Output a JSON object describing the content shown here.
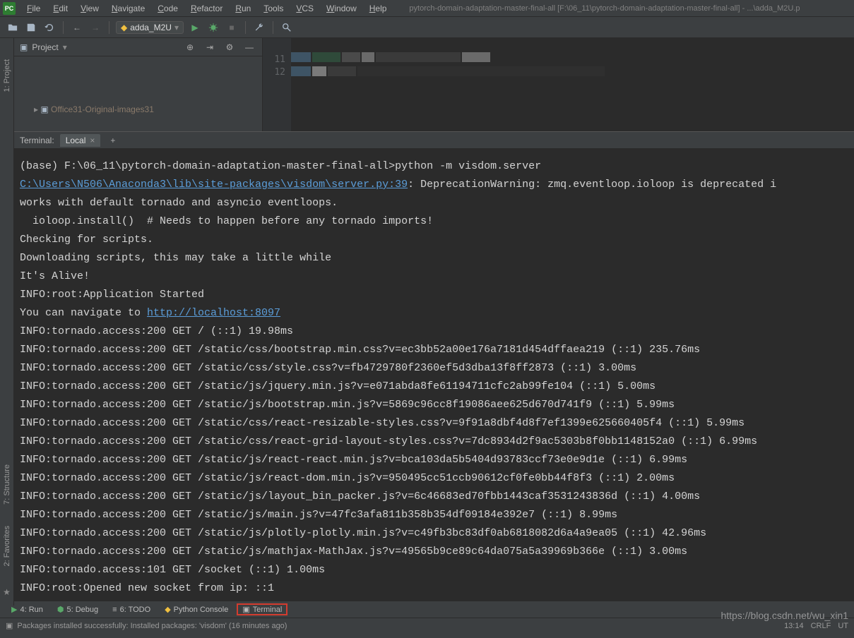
{
  "title": "pytorch-domain-adaptation-master-final-all [F:\\06_11\\pytorch-domain-adaptation-master-final-all] - ...\\adda_M2U.p",
  "menu": [
    "File",
    "Edit",
    "View",
    "Navigate",
    "Code",
    "Refactor",
    "Run",
    "Tools",
    "VCS",
    "Window",
    "Help"
  ],
  "run_config": "adda_M2U",
  "project_panel": {
    "title": "Project",
    "tree_item": "Office31-Original-images31"
  },
  "editor": {
    "line_numbers": [
      "11",
      "12"
    ]
  },
  "side_tabs": {
    "project": "1: Project",
    "structure": "7: Structure",
    "favorites": "2: Favorites"
  },
  "terminal": {
    "label": "Terminal:",
    "tab": "Local",
    "lines": [
      {
        "t": "plain",
        "v": ""
      },
      {
        "t": "plain",
        "v": "(base) F:\\06_11\\pytorch-domain-adaptation-master-final-all>python -m visdom.server"
      },
      {
        "t": "mixed",
        "parts": [
          {
            "k": "link",
            "v": "C:\\Users\\N506\\Anaconda3\\lib\\site-packages\\visdom\\server.py:39"
          },
          {
            "k": "plain",
            "v": ": DeprecationWarning: zmq.eventloop.ioloop is deprecated i"
          }
        ]
      },
      {
        "t": "plain",
        "v": "works with default tornado and asyncio eventloops."
      },
      {
        "t": "plain",
        "v": "  ioloop.install()  # Needs to happen before any tornado imports!"
      },
      {
        "t": "plain",
        "v": "Checking for scripts."
      },
      {
        "t": "plain",
        "v": "Downloading scripts, this may take a little while"
      },
      {
        "t": "plain",
        "v": "It's Alive!"
      },
      {
        "t": "plain",
        "v": "INFO:root:Application Started"
      },
      {
        "t": "mixed",
        "parts": [
          {
            "k": "plain",
            "v": "You can navigate to "
          },
          {
            "k": "link",
            "v": "http://localhost:8097"
          }
        ]
      },
      {
        "t": "plain",
        "v": "INFO:tornado.access:200 GET / (::1) 19.98ms"
      },
      {
        "t": "plain",
        "v": "INFO:tornado.access:200 GET /static/css/bootstrap.min.css?v=ec3bb52a00e176a7181d454dffaea219 (::1) 235.76ms"
      },
      {
        "t": "plain",
        "v": "INFO:tornado.access:200 GET /static/css/style.css?v=fb4729780f2360ef5d3dba13f8ff2873 (::1) 3.00ms"
      },
      {
        "t": "plain",
        "v": "INFO:tornado.access:200 GET /static/js/jquery.min.js?v=e071abda8fe61194711cfc2ab99fe104 (::1) 5.00ms"
      },
      {
        "t": "plain",
        "v": "INFO:tornado.access:200 GET /static/js/bootstrap.min.js?v=5869c96cc8f19086aee625d670d741f9 (::1) 5.99ms"
      },
      {
        "t": "plain",
        "v": "INFO:tornado.access:200 GET /static/css/react-resizable-styles.css?v=9f91a8dbf4d8f7ef1399e625660405f4 (::1) 5.99ms"
      },
      {
        "t": "plain",
        "v": "INFO:tornado.access:200 GET /static/css/react-grid-layout-styles.css?v=7dc8934d2f9ac5303b8f0bb1148152a0 (::1) 6.99ms"
      },
      {
        "t": "plain",
        "v": "INFO:tornado.access:200 GET /static/js/react-react.min.js?v=bca103da5b5404d93783ccf73e0e9d1e (::1) 6.99ms"
      },
      {
        "t": "plain",
        "v": "INFO:tornado.access:200 GET /static/js/react-dom.min.js?v=950495cc51ccb90612cf0fe0bb44f8f3 (::1) 2.00ms"
      },
      {
        "t": "plain",
        "v": "INFO:tornado.access:200 GET /static/js/layout_bin_packer.js?v=6c46683ed70fbb1443caf3531243836d (::1) 4.00ms"
      },
      {
        "t": "plain",
        "v": "INFO:tornado.access:200 GET /static/js/main.js?v=47fc3afa811b358b354df09184e392e7 (::1) 8.99ms"
      },
      {
        "t": "plain",
        "v": "INFO:tornado.access:200 GET /static/js/plotly-plotly.min.js?v=c49fb3bc83df0ab6818082d6a4a9ea05 (::1) 42.96ms"
      },
      {
        "t": "plain",
        "v": "INFO:tornado.access:200 GET /static/js/mathjax-MathJax.js?v=49565b9ce89c64da075a5a39969b366e (::1) 3.00ms"
      },
      {
        "t": "plain",
        "v": "INFO:tornado.access:101 GET /socket (::1) 1.00ms"
      },
      {
        "t": "plain",
        "v": "INFO:root:Opened new socket from ip: ::1"
      }
    ]
  },
  "bottom_buttons": {
    "run": "4: Run",
    "debug": "5: Debug",
    "todo": "6: TODO",
    "python_console": "Python Console",
    "terminal": "Terminal"
  },
  "status": {
    "message": "Packages installed successfully: Installed packages: 'visdom' (16 minutes ago)",
    "time": "13:14",
    "crlf": "CRLF",
    "encoding": "UT"
  },
  "watermark": "https://blog.csdn.net/wu_xin1"
}
